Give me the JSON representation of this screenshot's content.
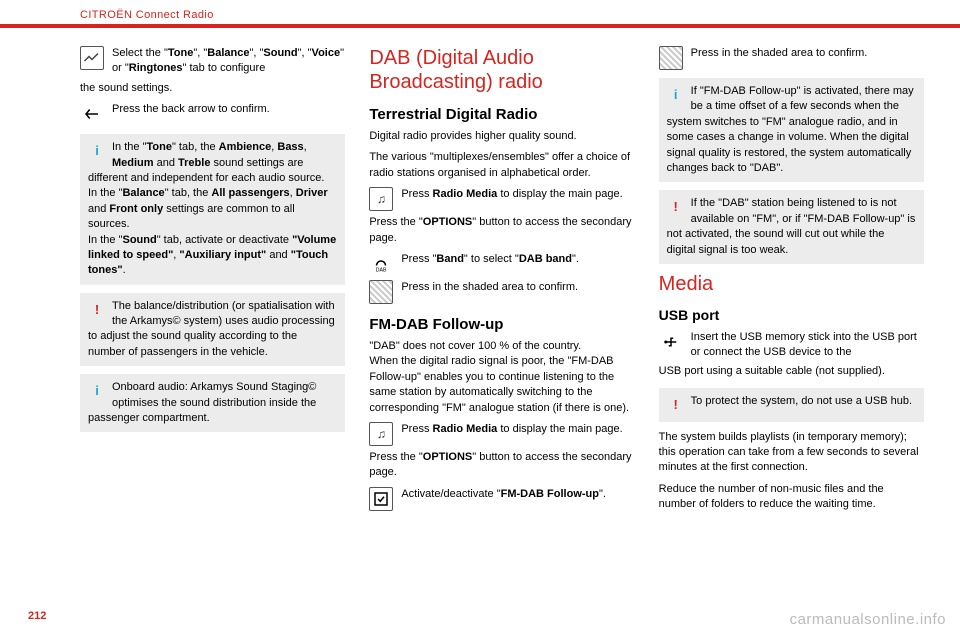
{
  "header": {
    "title": "CITROËN Connect Radio"
  },
  "page_number": "212",
  "watermark": "carmanualsonline.info",
  "col1": {
    "p1": "Select the \"Tone\", \"Balance\", \"Sound\", \"Voice\" or \"Ringtones\" tab to configure the sound settings.",
    "p2": "Press the back arrow to confirm.",
    "note1": "In the \"Tone\" tab, the Ambience, Bass, Medium and Treble sound settings are different and independent for each audio source.\nIn the \"Balance\" tab, the All passengers, Driver and Front only settings are common to all sources.\nIn the \"Sound\" tab, activate or deactivate \"Volume linked to speed\", \"Auxiliary input\" and \"Touch tones\".",
    "warn1": "The balance/distribution (or spatialisation with the Arkamys© system) uses audio processing to adjust the sound quality according to the number of passengers in the vehicle.",
    "note2": "Onboard audio: Arkamys Sound Staging© optimises the sound distribution inside the passenger compartment."
  },
  "col2": {
    "h2": "DAB (Digital Audio Broadcasting) radio",
    "h3a": "Terrestrial Digital Radio",
    "p1": "Digital radio provides higher quality sound.",
    "p2": "The various \"multiplexes/ensembles\" offer a choice of radio stations organised in alphabetical order.",
    "p3": "Press Radio Media to display the main page.",
    "p4": "Press the \"OPTIONS\" button to access the secondary page.",
    "p5": "Press \"Band\" to select \"DAB band\".",
    "p6": "Press in the shaded area to confirm.",
    "h3b": "FM-DAB Follow-up",
    "p7": "\"DAB\" does not cover 100 % of the country.\nWhen the digital radio signal is poor, the \"FM-DAB Follow-up\" enables you to continue listening to the same station by automatically switching to the corresponding \"FM\" analogue station (if there is one).",
    "p8": "Press Radio Media to display the main page.",
    "p9": "Press the \"OPTIONS\" button to access the secondary page.",
    "p10": "Activate/deactivate \"FM-DAB Follow-up\"."
  },
  "col3": {
    "p1": "Press in the shaded area to confirm.",
    "note1": "If \"FM-DAB Follow-up\" is activated, there may be a time offset of a few seconds when the system switches to \"FM\" analogue radio, and in some cases a change in volume. When the digital signal quality is restored, the system automatically changes back to \"DAB\".",
    "warn1": "If the \"DAB\" station being listened to is not available on \"FM\", or if \"FM-DAB Follow-up\" is not activated, the sound will cut out while the digital signal is too weak.",
    "h2": "Media",
    "h3": "USB port",
    "p2": "Insert the USB memory stick into the USB port or connect the USB device to the USB port using a suitable cable (not supplied).",
    "warn2": "To protect the system, do not use a USB hub.",
    "p3": "The system builds playlists (in temporary memory); this operation can take from a few seconds to several minutes at the first connection.",
    "p4": "Reduce the number of non-music files and the number of folders to reduce the waiting time."
  }
}
